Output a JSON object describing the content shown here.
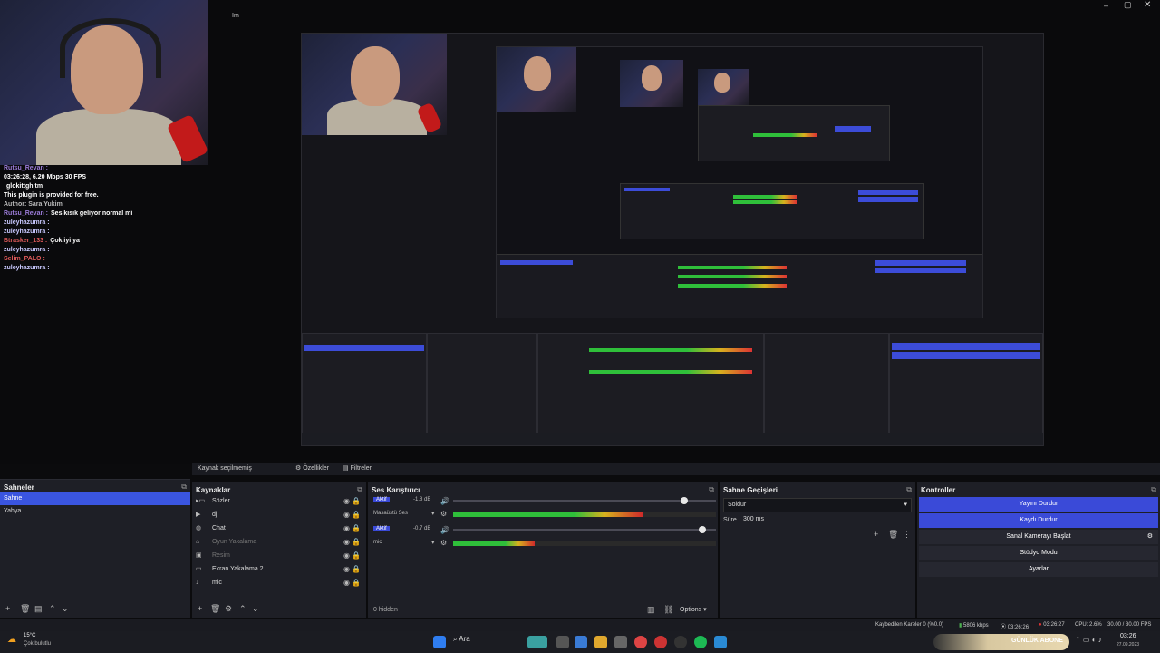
{
  "window": {
    "title": "Im",
    "controls": [
      "minimize-icon",
      "maximize-icon",
      "close-icon"
    ]
  },
  "preview_overlay": {
    "chat_lines": [
      {
        "user": "Rutsu_Revan :",
        "text": "",
        "color": "#9b7bd8"
      },
      {
        "user": "03:26:28, 6.20 Mbps 30 FPS",
        "text": "",
        "color": "#ffffff"
      },
      {
        "user": "",
        "text": "glokittgh tm",
        "color": "#d84a4a"
      },
      {
        "user": "This plugin is provided for free.",
        "text": "",
        "color": "#ffffff"
      },
      {
        "user": "Author: Sara Yukim",
        "text": "",
        "color": "#bbbbbb"
      },
      {
        "user": "Rutsu_Revan :",
        "text": "Ses kısık geliyor normal mi",
        "color": "#9b7bd8"
      },
      {
        "user": "zuleyhazumra :",
        "text": "",
        "color": "#c9c9ff"
      },
      {
        "user": "zuleyhazumra :",
        "text": "",
        "color": "#c9c9ff"
      },
      {
        "user": "Btrasker_133 :",
        "text": "Çok iyi ya",
        "color": "#e05a5a"
      },
      {
        "user": "zuleyhazumra :",
        "text": "",
        "color": "#c9c9ff"
      },
      {
        "user": "Selim_PALO :",
        "text": "",
        "color": "#e05a5a"
      },
      {
        "user": "zuleyhazumra :",
        "text": "",
        "color": "#c9c9ff"
      }
    ]
  },
  "source_toolbar": {
    "no_source": "Kaynak seçilmemiş",
    "properties": "Özellikler",
    "filters": "Filtreler"
  },
  "scenes": {
    "title": "Sahneler",
    "items": [
      {
        "label": "Sahne",
        "selected": true
      },
      {
        "label": "Yahya",
        "selected": false
      }
    ]
  },
  "sources": {
    "title": "Kaynaklar",
    "items": [
      {
        "label": "Sözler",
        "type": "folder",
        "dim": false
      },
      {
        "label": "dj",
        "type": "media",
        "dim": false
      },
      {
        "label": "Chat",
        "type": "browser",
        "dim": false
      },
      {
        "label": "Oyun Yakalama",
        "type": "game",
        "dim": true
      },
      {
        "label": "Resim",
        "type": "image",
        "dim": true
      },
      {
        "label": "Ekran Yakalama 2",
        "type": "display",
        "dim": false
      },
      {
        "label": "mic",
        "type": "audio",
        "dim": false
      }
    ]
  },
  "mixer": {
    "title": "Ses Karıştırıcı",
    "channels": [
      {
        "name": "Masaüstü Ses",
        "badge": "Aktif",
        "db": "-1.8 dB",
        "level": 0.72,
        "volume": 0.89,
        "badge_color": "#3a4ad8"
      },
      {
        "name": "mic",
        "badge": "Aktif",
        "db": "-0.7 dB",
        "level": 0.31,
        "volume": 0.96,
        "badge_color": "#3a4ad8"
      }
    ],
    "scale": [
      "-60",
      "-55",
      "-50",
      "-45",
      "-40",
      "-35",
      "-30",
      "-25",
      "-20",
      "-15",
      "-10",
      "-5",
      "0"
    ],
    "hidden": "0 hidden",
    "options": "Options"
  },
  "transitions": {
    "title": "Sahne Geçişleri",
    "selected": "Soldur",
    "duration_label": "Süre",
    "duration_value": "300 ms"
  },
  "controls": {
    "title": "Kontroller",
    "buttons": [
      {
        "label": "Yayını Durdur",
        "style": "blue"
      },
      {
        "label": "Kaydı Durdur",
        "style": "blue"
      },
      {
        "label": "Sanal Kamerayı Başlat",
        "style": "dark"
      },
      {
        "label": "Stüdyo Modu",
        "style": "dark"
      },
      {
        "label": "Ayarlar",
        "style": "dark"
      }
    ]
  },
  "status": {
    "dropped": "Kaybedilen Kareler 0 (%0.0)",
    "bitrate": "5806 kbps",
    "stream_time": "03:26:26",
    "rec_time": "03:26:27",
    "cpu": "CPU: 2.6%",
    "fps": "30.00 / 30.00 FPS"
  },
  "taskbar": {
    "weather_temp": "15°C",
    "weather_text": "Çok bulutlu",
    "search": "Ara",
    "tray_text": "GÜNLÜK ABONE",
    "clock": "03:26",
    "date": "27.09.2023"
  }
}
